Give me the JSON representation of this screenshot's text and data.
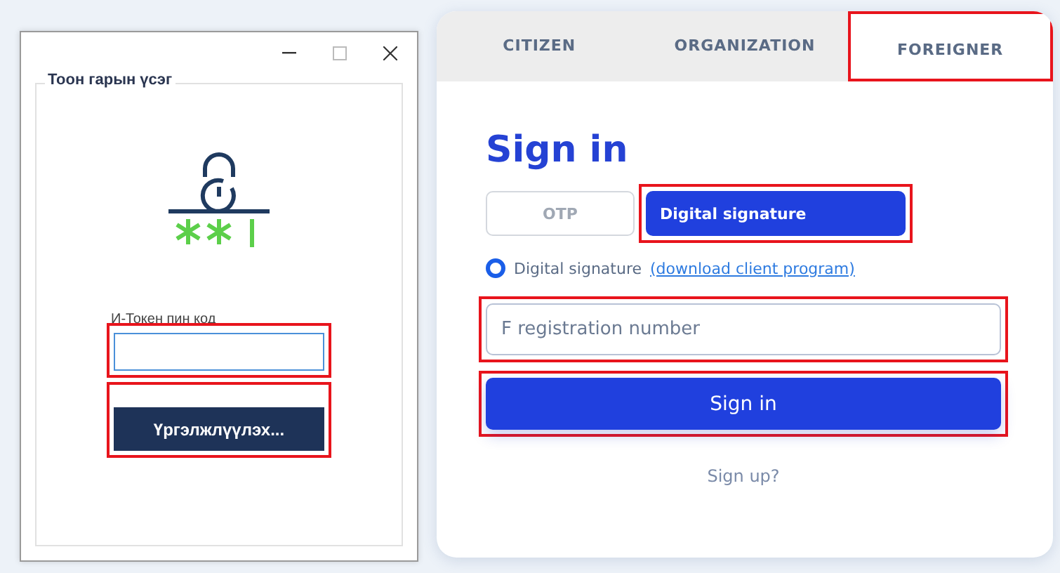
{
  "pin_dialog": {
    "group_title": "Тоон гарын үсэг",
    "pin_label": "И-Токен пин код",
    "pin_field": {
      "highlighted": true
    },
    "continue_button": {
      "label": "Үргэлжлүүлэх...",
      "highlighted": true
    }
  },
  "login_card": {
    "tabs": [
      {
        "label": "CITIZEN",
        "selected": false,
        "highlighted": false
      },
      {
        "label": "ORGANIZATION",
        "selected": false,
        "highlighted": false
      },
      {
        "label": "FOREIGNER",
        "selected": true,
        "highlighted": true
      }
    ],
    "title": "Sign in",
    "methods": [
      {
        "label": "OTP",
        "selected": false,
        "highlighted": false
      },
      {
        "label": "Digital signature",
        "selected": true,
        "highlighted": true
      }
    ],
    "radio": {
      "label": "Digital signature",
      "link": "(download client program)",
      "checked": true
    },
    "registration_field": {
      "placeholder": "F registration number",
      "highlighted": true
    },
    "sign_in_button": {
      "label": "Sign in",
      "highlighted": true
    },
    "sign_up_link": "Sign up?"
  }
}
